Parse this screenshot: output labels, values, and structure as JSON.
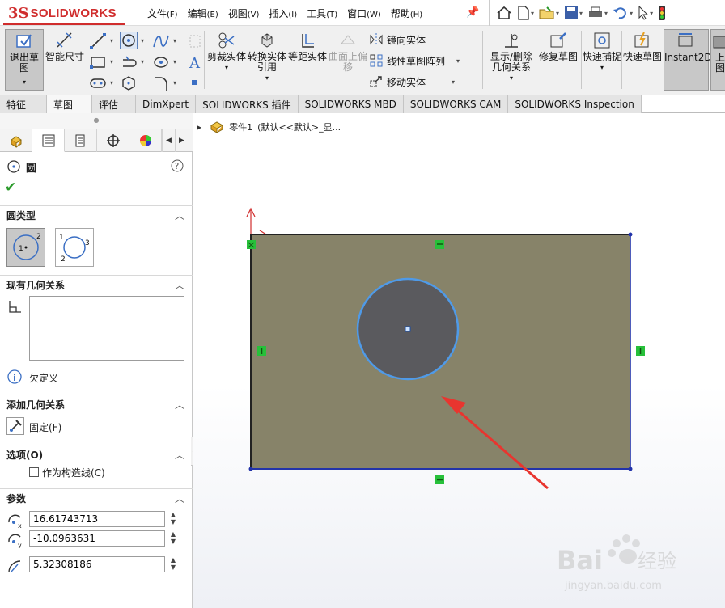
{
  "app": {
    "logo_prefix": "3S",
    "logo_name": "SOLIDWORKS"
  },
  "menu": [
    {
      "label": "文件",
      "key": "(F)"
    },
    {
      "label": "编辑",
      "key": "(E)"
    },
    {
      "label": "视图",
      "key": "(V)"
    },
    {
      "label": "插入",
      "key": "(I)"
    },
    {
      "label": "工具",
      "key": "(T)"
    },
    {
      "label": "窗口",
      "key": "(W)"
    },
    {
      "label": "帮助",
      "key": "(H)"
    }
  ],
  "toolbar": {
    "exit_sketch": "退出草图",
    "smart_dim": "智能尺寸",
    "trim": "剪裁实体",
    "convert": "转换实体引用",
    "offset": "等距实体",
    "surface_offset": "曲面上偏移",
    "mirror": "镜向实体",
    "linear_pattern": "线性草图阵列",
    "move": "移动实体",
    "show_relations": "显示/删除几何关系",
    "repair": "修复草图",
    "quick_snap": "快速捕捉",
    "rapid_sketch": "快速草图",
    "instant2d": "Instant2D",
    "cut_off": "上图"
  },
  "tabs": [
    {
      "label": "特征"
    },
    {
      "label": "草图"
    },
    {
      "label": "评估"
    },
    {
      "label": "DimXpert"
    },
    {
      "label": "SOLIDWORKS 插件"
    },
    {
      "label": "SOLIDWORKS MBD"
    },
    {
      "label": "SOLIDWORKS CAM"
    },
    {
      "label": "SOLIDWORKS Inspection"
    }
  ],
  "property_manager": {
    "title": "圆",
    "sections": {
      "circle_type": "圆类型",
      "existing_relations": "现有几何关系",
      "status": "欠定义",
      "add_relations": "添加几何关系",
      "fix": "固定(F)",
      "options": "选项(O)",
      "construction": "作为构造线(C)",
      "parameters": "参数"
    },
    "params": {
      "cx": "16.61743713",
      "cy": "-10.0963631",
      "radius": "5.32308186"
    },
    "circle_type_labels": {
      "center_num_1": "1",
      "center_num_2": "2",
      "perim_1": "1",
      "perim_2": "2",
      "perim_3": "3"
    }
  },
  "tree": {
    "part_label": "零件1",
    "config": "(默认<<默认>_显..."
  },
  "watermark": {
    "brand": "Bai",
    "brand_suffix": "经验",
    "url": "jingyan.baidu.com"
  },
  "colors": {
    "accent_red": "#d02d2d",
    "sketch_fill": "#878369",
    "circle_fill": "#5a5a5e",
    "circle_edge": "#4f9ae8",
    "relation_green": "#27c03a",
    "arrow_red": "#e8352f"
  }
}
